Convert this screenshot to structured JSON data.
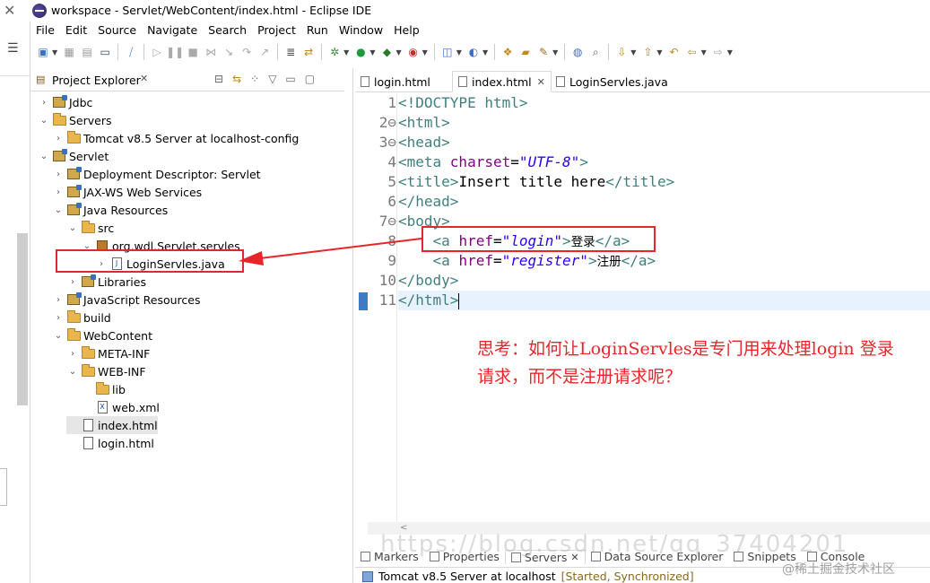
{
  "window": {
    "title": "workspace - Servlet/WebContent/index.html - Eclipse IDE"
  },
  "menu": [
    "File",
    "Edit",
    "Source",
    "Navigate",
    "Search",
    "Project",
    "Run",
    "Window",
    "Help"
  ],
  "explorer": {
    "title": "Project Explorer",
    "tree": [
      {
        "label": "Jdbc",
        "indent": 0,
        "twist": ">",
        "icon": "project-icon"
      },
      {
        "label": "Servers",
        "indent": 0,
        "twist": "v",
        "icon": "folder-icon"
      },
      {
        "label": "Tomcat v8.5 Server at localhost-config",
        "indent": 1,
        "twist": ">",
        "icon": "folder-icon"
      },
      {
        "label": "Servlet",
        "indent": 0,
        "twist": "v",
        "icon": "project-icon"
      },
      {
        "label": "Deployment Descriptor: Servlet",
        "indent": 1,
        "twist": ">",
        "icon": "deployment-descriptor-icon"
      },
      {
        "label": "JAX-WS Web Services",
        "indent": 1,
        "twist": ">",
        "icon": "web-services-icon"
      },
      {
        "label": "Java Resources",
        "indent": 1,
        "twist": "v",
        "icon": "java-resources-icon"
      },
      {
        "label": "src",
        "indent": 2,
        "twist": "v",
        "icon": "source-folder-icon"
      },
      {
        "label": "org.wdl.Servlet.servles",
        "indent": 3,
        "twist": "v",
        "icon": "package-icon"
      },
      {
        "label": "LoginServles.java",
        "indent": 4,
        "twist": ">",
        "icon": "java-file-icon"
      },
      {
        "label": "Libraries",
        "indent": 2,
        "twist": ">",
        "icon": "libraries-icon"
      },
      {
        "label": "JavaScript Resources",
        "indent": 1,
        "twist": ">",
        "icon": "js-resources-icon"
      },
      {
        "label": "build",
        "indent": 1,
        "twist": ">",
        "icon": "folder-icon"
      },
      {
        "label": "WebContent",
        "indent": 1,
        "twist": "v",
        "icon": "folder-icon"
      },
      {
        "label": "META-INF",
        "indent": 2,
        "twist": ">",
        "icon": "folder-icon"
      },
      {
        "label": "WEB-INF",
        "indent": 2,
        "twist": "v",
        "icon": "folder-icon"
      },
      {
        "label": "lib",
        "indent": 3,
        "twist": "",
        "icon": "folder-icon"
      },
      {
        "label": "web.xml",
        "indent": 3,
        "twist": "",
        "icon": "xml-file-icon"
      },
      {
        "label": "index.html",
        "indent": 2,
        "twist": "",
        "icon": "html-file-icon",
        "selected": true
      },
      {
        "label": "login.html",
        "indent": 2,
        "twist": "",
        "icon": "html-file-icon"
      }
    ]
  },
  "editor": {
    "tabs": [
      {
        "label": "login.html",
        "active": false
      },
      {
        "label": "index.html",
        "active": true
      },
      {
        "label": "LoginServles.java",
        "active": false
      }
    ],
    "line_numbers": [
      "1",
      "2⊖",
      "3⊖",
      "4",
      "5",
      "6",
      "7⊖",
      "8",
      "9",
      "10",
      "11"
    ],
    "code": {
      "l1": {
        "tag": "<!DOCTYPE html>"
      },
      "l2": {
        "tag": "<html>"
      },
      "l3": {
        "tag": "<head>"
      },
      "l4": {
        "open": "<meta ",
        "attr": "charset",
        "eq": "=",
        "val": "\"UTF-8\"",
        "close": ">"
      },
      "l5": {
        "open": "<title>",
        "text": "Insert title here",
        "close": "</title>"
      },
      "l6": {
        "tag": "</head>"
      },
      "l7": {
        "tag": "<body>"
      },
      "l8": {
        "open": "<a ",
        "attr": "href",
        "eq": "=",
        "val": "\"login\"",
        "mid": ">",
        "text": "登录",
        "close": "</a>"
      },
      "l9": {
        "open": "<a ",
        "attr": "href",
        "eq": "=",
        "val": "\"register\"",
        "mid": ">",
        "text": "注册",
        "close": "</a>"
      },
      "l10": {
        "tag": "</body>"
      },
      "l11": {
        "tag": "</html>"
      }
    },
    "annotation": "思考：如何让LoginServles是专门用来处理login 登录请求，而不是注册请求呢？"
  },
  "bottom_panel": {
    "tabs": [
      "Markers",
      "Properties",
      "Servers",
      "Data Source Explorer",
      "Snippets",
      "Console"
    ],
    "server_row": {
      "name": "Tomcat v8.5 Server at localhost",
      "status": "[Started, Synchronized]"
    }
  },
  "watermark": {
    "url": "https://blog.csdn.net/qq_37404201",
    "site": "@稀土掘金技术社区"
  },
  "colors": {
    "annotation": "#e8262a",
    "tag": "#3f7f7f",
    "attr": "#7f007f",
    "value": "#2a00ff"
  }
}
